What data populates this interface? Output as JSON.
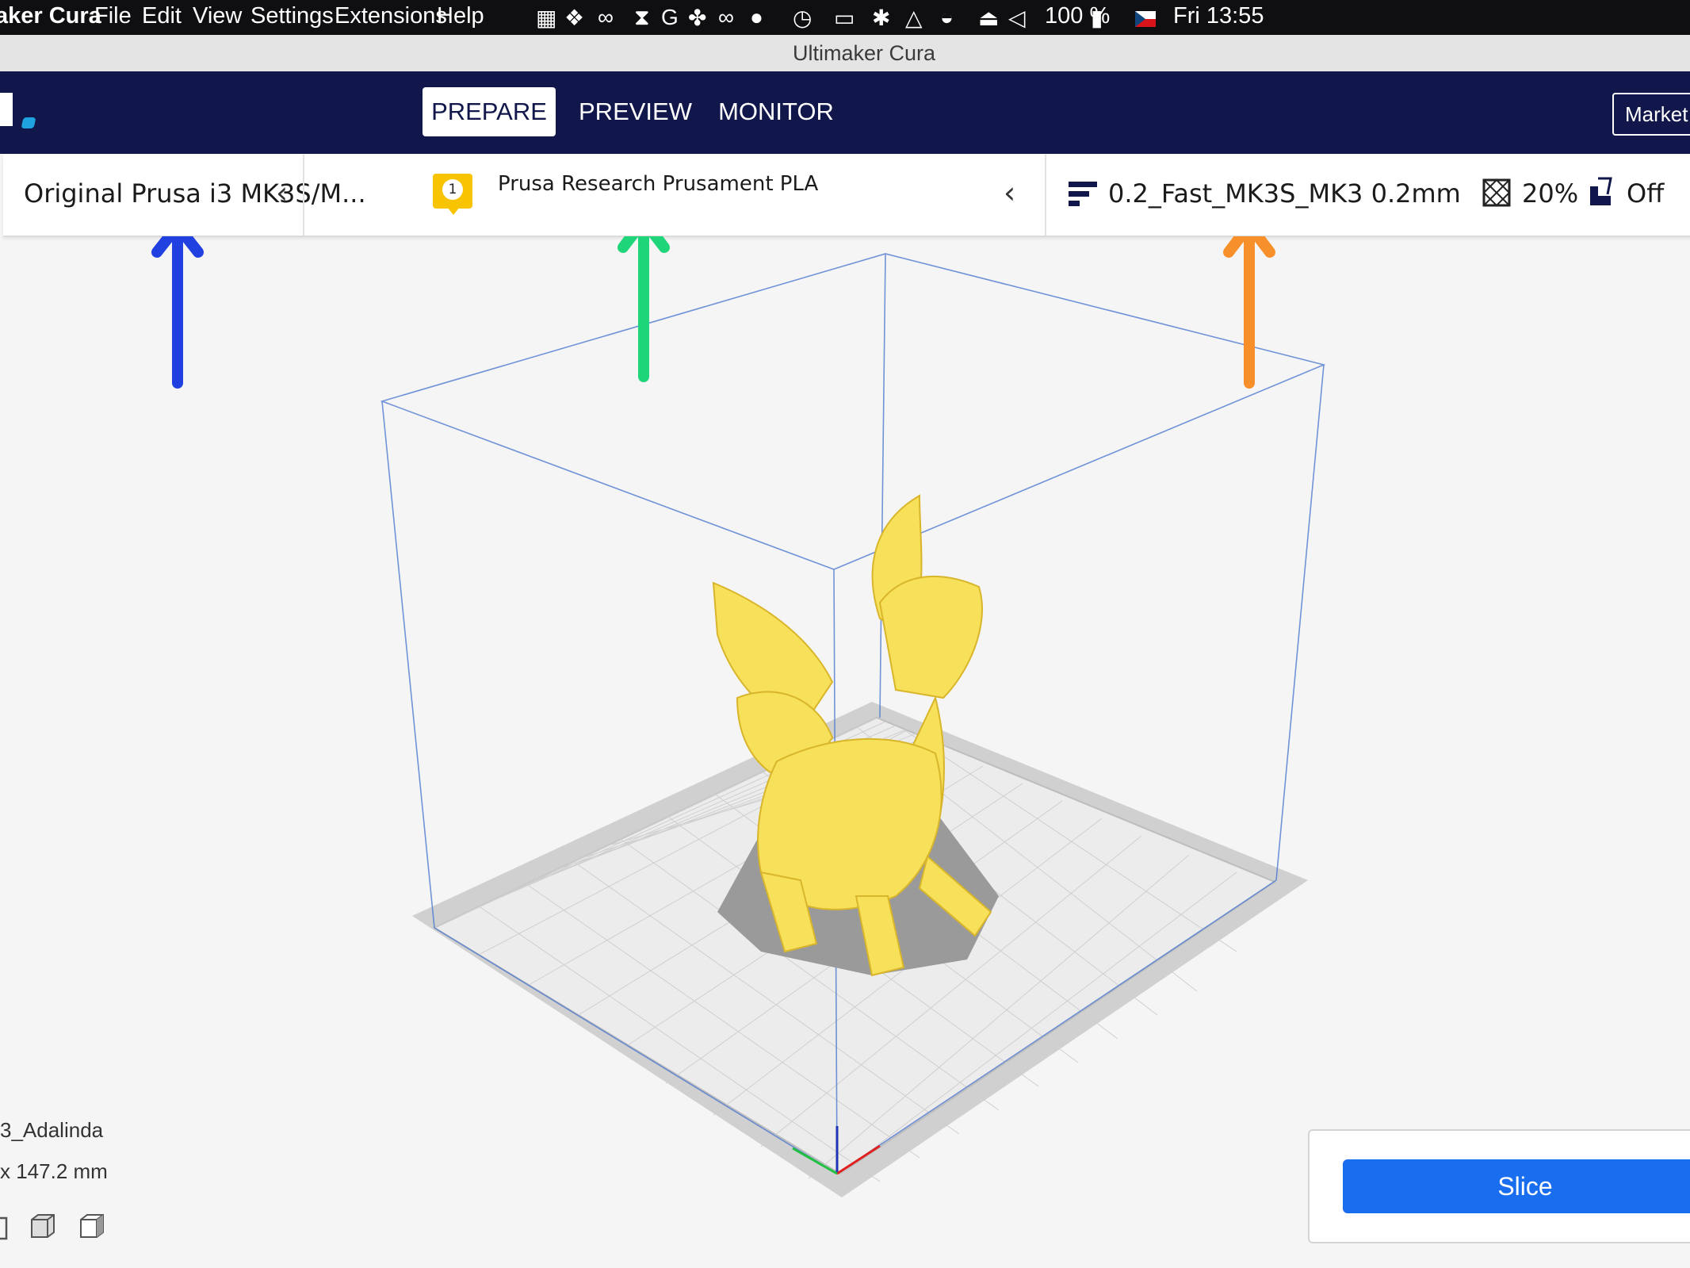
{
  "menubar": {
    "app_name": "aker Cura",
    "items": [
      "File",
      "Edit",
      "View",
      "Settings",
      "Extensions",
      "Help"
    ],
    "status_icons": [
      "bookmark-icon",
      "dropbox-icon",
      "creative-cloud-icon",
      "paperclip-icon",
      "grammarly-icon",
      "satellite-icon",
      "glasses-icon",
      "notification-icon",
      "time-machine-icon",
      "battery-meter-icon",
      "bluetooth-icon",
      "airplay-icon",
      "wifi-icon",
      "eject-icon",
      "volume-icon",
      "charging-battery-icon",
      "flag-cz-icon"
    ],
    "battery": "100 %",
    "clock": "Fri 13:55"
  },
  "window": {
    "title": "Ultimaker Cura"
  },
  "header": {
    "stages": [
      {
        "label": "PREPARE",
        "active": true
      },
      {
        "label": "PREVIEW",
        "active": false
      },
      {
        "label": "MONITOR",
        "active": false
      }
    ],
    "marketplace_label": "Market"
  },
  "settings_bar": {
    "printer": "Original Prusa i3 MK3S/M...",
    "extruder_number": "1",
    "material": "Prusa Research Prusament PLA",
    "profile": "0.2_Fast_MK3S_MK3 0.2mm",
    "infill": "20%",
    "support": "Off"
  },
  "annotations": {
    "colors": {
      "printer_arrow": "#2040e0",
      "material_arrow": "#1fd57a",
      "profile_arrow": "#f7902a"
    }
  },
  "object_info": {
    "name": "3_Adalinda",
    "dimensions": "x 147.2 mm"
  },
  "slice_panel": {
    "button_label": "Slice"
  },
  "colors": {
    "header_bg": "#11174a",
    "accent": "#196ef0",
    "model": "#f7e05a"
  }
}
